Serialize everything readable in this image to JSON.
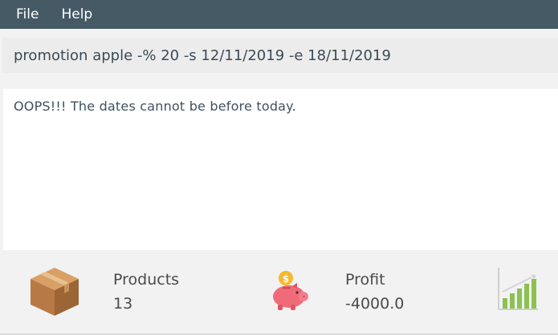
{
  "menu": {
    "file_label": "File",
    "help_label": "Help"
  },
  "command": {
    "value": "promotion apple -% 20 -s 12/11/2019 -e 18/11/2019"
  },
  "result": {
    "message": "OOPS!!! The dates cannot be before today."
  },
  "status": {
    "products_label": "Products",
    "products_value": "13",
    "profit_label": "Profit",
    "profit_value": "-4000.0"
  },
  "icons": {
    "products": "box-icon",
    "profit": "piggy-bank-icon",
    "trend": "bar-chart-growth-icon"
  },
  "colors": {
    "menubar": "#465a66",
    "text": "#3f5160",
    "piggy": "#f06b7a",
    "coin": "#f5b82e",
    "bars": "#8cc152"
  }
}
